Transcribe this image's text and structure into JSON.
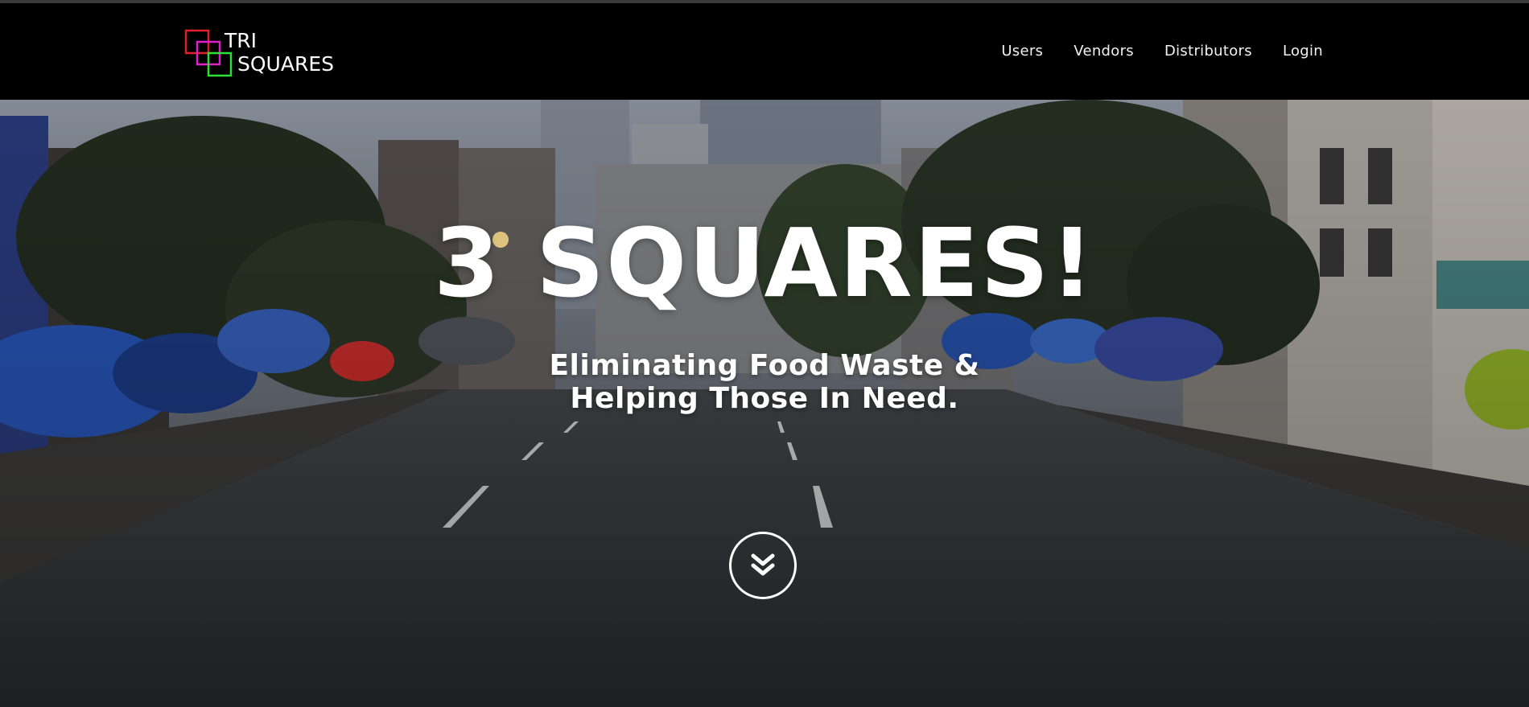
{
  "brand": {
    "name_line1": "TRI",
    "name_line2": "SQUARES",
    "colors": {
      "red": "#e0202a",
      "magenta": "#e020c8",
      "green": "#2ee03a"
    }
  },
  "nav": {
    "items": [
      {
        "label": "Users"
      },
      {
        "label": "Vendors"
      },
      {
        "label": "Distributors"
      },
      {
        "label": "Login"
      }
    ]
  },
  "hero": {
    "title": "3 SQUARES!",
    "subtitle_line1": "Eliminating Food Waste &",
    "subtitle_line2": "Helping Those In Need.",
    "scroll_icon": "chevron-double-down-icon",
    "background_image": "city-street-photo"
  }
}
